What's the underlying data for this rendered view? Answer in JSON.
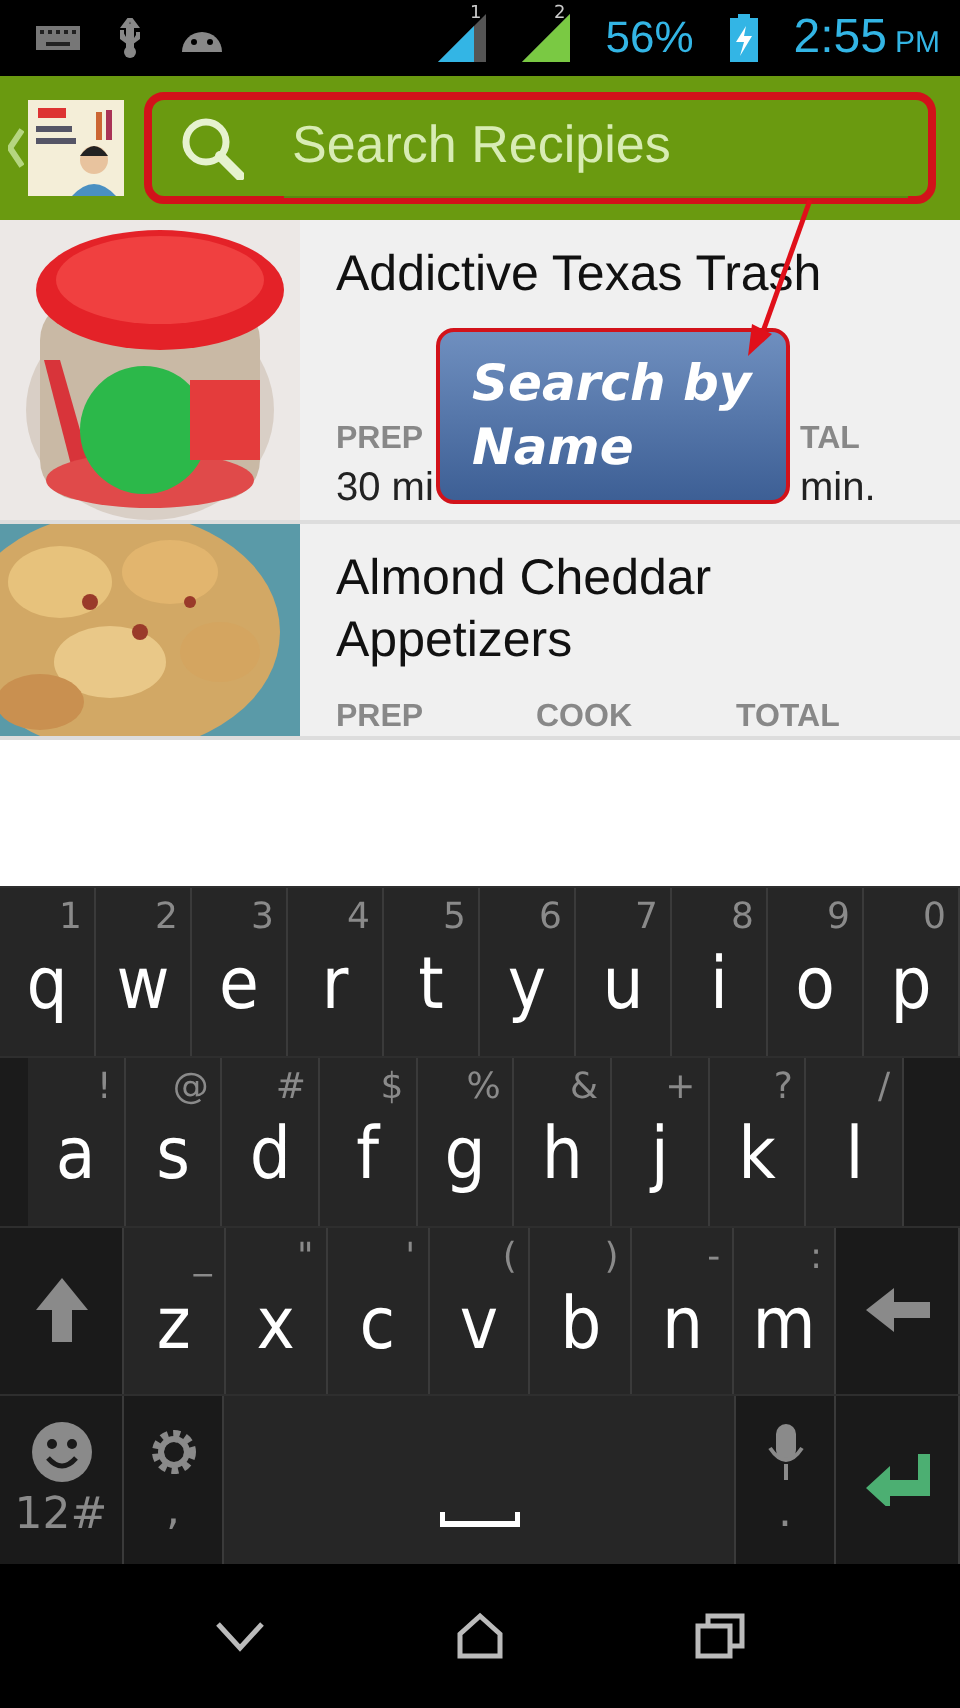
{
  "status_bar": {
    "sim_labels": [
      "1",
      "2"
    ],
    "battery": "56%",
    "time": "2:55",
    "meridiem": "PM"
  },
  "search": {
    "placeholder": "Search Recipies"
  },
  "recipes": [
    {
      "title": "Addictive Texas Trash",
      "covered": true,
      "stats": [
        {
          "label": "PREP",
          "value": "30 mi"
        },
        {
          "label": "TAL",
          "value": "min."
        }
      ]
    },
    {
      "title": "Almond Cheddar Appetizers",
      "covered": false,
      "stats": [
        {
          "label": "PREP"
        },
        {
          "label": "COOK"
        },
        {
          "label": "TOTAL"
        }
      ]
    }
  ],
  "callout": {
    "text": "Search by Name"
  },
  "keyboard": [
    [
      {
        "kind": "char",
        "key": "q",
        "hint": "1"
      },
      {
        "kind": "char",
        "key": "w",
        "hint": "2"
      },
      {
        "kind": "char",
        "key": "e",
        "hint": "3"
      },
      {
        "kind": "char",
        "key": "r",
        "hint": "4"
      },
      {
        "kind": "char",
        "key": "t",
        "hint": "5"
      },
      {
        "kind": "char",
        "key": "y",
        "hint": "6"
      },
      {
        "kind": "char",
        "key": "u",
        "hint": "7"
      },
      {
        "kind": "char",
        "key": "i",
        "hint": "8"
      },
      {
        "kind": "char",
        "key": "o",
        "hint": "9"
      },
      {
        "kind": "char",
        "key": "p",
        "hint": "0"
      }
    ],
    [
      {
        "kind": "char",
        "key": "a",
        "hint": "!"
      },
      {
        "kind": "char",
        "key": "s",
        "hint": "@"
      },
      {
        "kind": "char",
        "key": "d",
        "hint": "#"
      },
      {
        "kind": "char",
        "key": "f",
        "hint": "$"
      },
      {
        "kind": "char",
        "key": "g",
        "hint": "%"
      },
      {
        "kind": "char",
        "key": "h",
        "hint": "&"
      },
      {
        "kind": "char",
        "key": "j",
        "hint": "+"
      },
      {
        "kind": "char",
        "key": "k",
        "hint": "?"
      },
      {
        "kind": "char",
        "key": "l",
        "hint": "/"
      }
    ],
    [
      {
        "kind": "shift"
      },
      {
        "kind": "char",
        "key": "z",
        "hint": "_"
      },
      {
        "kind": "char",
        "key": "x",
        "hint": "\""
      },
      {
        "kind": "char",
        "key": "c",
        "hint": "'"
      },
      {
        "kind": "char",
        "key": "v",
        "hint": "("
      },
      {
        "kind": "char",
        "key": "b",
        "hint": ")"
      },
      {
        "kind": "char",
        "key": "n",
        "hint": "-"
      },
      {
        "kind": "char",
        "key": "m",
        "hint": ":"
      },
      {
        "kind": "backspace"
      }
    ],
    [
      {
        "kind": "emoji",
        "key": "12#"
      },
      {
        "kind": "settings",
        "key": ","
      },
      {
        "kind": "space"
      },
      {
        "kind": "mic",
        "key": "."
      },
      {
        "kind": "enter"
      }
    ]
  ]
}
